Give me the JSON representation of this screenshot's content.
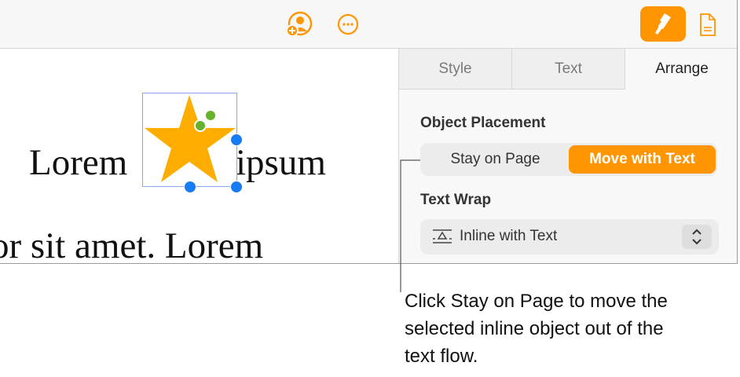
{
  "toolbar": {
    "icons": [
      "collaborate-icon",
      "more-icon",
      "format-brush-icon",
      "document-icon"
    ]
  },
  "document": {
    "line1_left": "Lorem",
    "line1_right": "ipsum",
    "line2": "or sit amet. Lorem"
  },
  "sidebar": {
    "tabs": [
      {
        "label": "Style"
      },
      {
        "label": "Text"
      },
      {
        "label": "Arrange",
        "active": true
      }
    ],
    "object_placement": {
      "heading": "Object Placement",
      "options": [
        "Stay on Page",
        "Move with Text"
      ],
      "selected": "Move with Text"
    },
    "text_wrap": {
      "heading": "Text Wrap",
      "value": "Inline with Text"
    }
  },
  "callout": "Click Stay on Page to move the selected inline object out of the text flow.",
  "colors": {
    "accent": "#ff9500",
    "handle": "#1a7cf5",
    "star": "#ffad00"
  }
}
